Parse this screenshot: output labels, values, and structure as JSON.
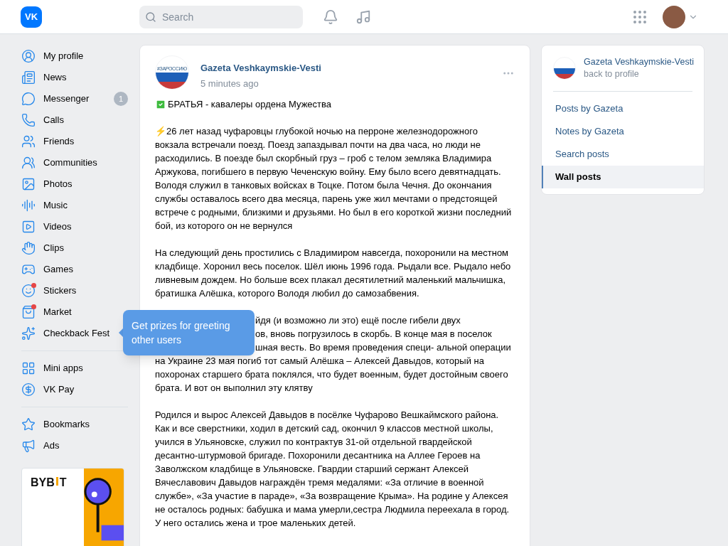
{
  "header": {
    "logo": "VK",
    "search": {
      "placeholder": "Search"
    }
  },
  "sidebar": {
    "groups": [
      [
        {
          "label": "My profile"
        },
        {
          "label": "News"
        },
        {
          "label": "Messenger",
          "badge": "1"
        },
        {
          "label": "Calls"
        },
        {
          "label": "Friends"
        },
        {
          "label": "Communities"
        },
        {
          "label": "Photos"
        },
        {
          "label": "Music"
        },
        {
          "label": "Videos"
        },
        {
          "label": "Clips"
        },
        {
          "label": "Games"
        },
        {
          "label": "Stickers",
          "dot": true
        },
        {
          "label": "Market",
          "dot": true
        },
        {
          "label": "Checkback Fest"
        }
      ],
      [
        {
          "label": "Mini apps"
        },
        {
          "label": "VK Pay"
        }
      ],
      [
        {
          "label": "Bookmarks"
        },
        {
          "label": "Ads"
        }
      ]
    ],
    "ad": {
      "logo_left": "BYB",
      "logo_right": "T"
    }
  },
  "tooltip": "Get prizes for greeting other users",
  "post": {
    "author": "Gazeta Veshkaymskie-Vesti",
    "time": "5 minutes ago",
    "avatar_text": "#ЗАРОССИЮ",
    "title": "БРАТЬЯ - кавалеры ордена Мужества",
    "paragraphs": [
      {
        "kind": "text",
        "emoji": "⚡",
        "text": "26 лет назад чуфаровцы глубокой ночью на перроне железнодорожного вокзала встречали поезд. Поезд запаздывал почти на два часа, но люди не расходились. В поезде был скорбный груз – гроб с телом земляка Владимира Аржукова, погибшего в первую Чеченскую войну. Ему было всего девятнадцать. Володя служил в танковых войсках в Тоцке. Потом была Чечня. До окончания службы оставалось всего два месяца, парень уже жил мечтами о предстоящей встрече с родными, близкими и друзьями. Но был в его короткой жизни последний бой, из которого он не вернулся"
      },
      {
        "kind": "text",
        "text": "На следующий день простились с Владимиром навсегда, похоронили на местном кладбище. Хоронил весь поселок. Шёл июнь 1996 года. Рыдали все. Рыдало небо ливневым дождем. Но больше всех плакал десятилетний маленький мальчишка, братишка Алёшка, которого Володя любил до самозабвения."
      },
      {
        "kind": "lines",
        "partial_lines": [
          "йдя (и возможно ли это) ещё после гибели двух",
          "ов, вновь погрузилось в скорбь. В конце мая в поселок",
          "шная весть. Во время проведения специ- альной операции"
        ],
        "lines": [
          "на Украине 23 мая погиб тот самый Алёшка – Алексей Давыдов, который на",
          "похоронах старшего брата поклялся, что будет военным, будет достойным своего",
          "брата. И вот он выполнил эту клятву"
        ]
      },
      {
        "kind": "text",
        "text": "Родился и вырос Алексей Давыдов в посёлке Чуфарово Вешкаймского района. Как и все сверстники, ходил в детский сад, окончил 9 классов местной школы, учился в Ульяновске, служил по контрактув 31-ой отдельной гвардейской десантно-штурмовой бригаде. Похоронили десантника на Аллее Героев на Заволжском кладбище в Ульяновске. Гвардии старший сержант Алексей Вячеславович Давыдов награждён тремя медалями: «За отличие в военной службе», «За участие в параде», «За возвращение Крыма». На родине у Алексея не осталось родных: бабушка и мама умерли,сестра Людмила переехала в город. У него остались жена и трое маленьких детей."
      }
    ]
  },
  "right": {
    "name": "Gazeta Veshkaymskie-Vesti",
    "sub": "back to profile",
    "links": [
      {
        "label": "Posts by Gazeta",
        "selected": false
      },
      {
        "label": "Notes by Gazeta",
        "selected": false
      },
      {
        "label": "Search posts",
        "selected": false
      },
      {
        "label": "Wall posts",
        "selected": true
      }
    ]
  }
}
